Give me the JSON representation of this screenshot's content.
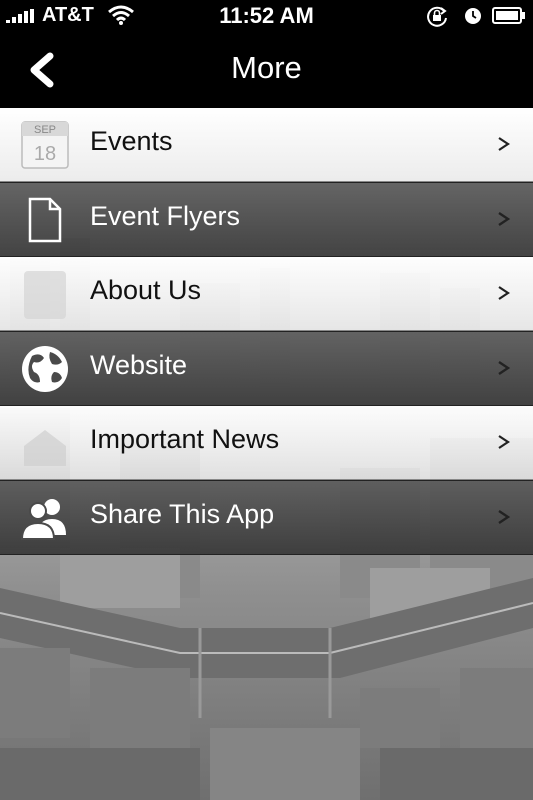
{
  "status_bar": {
    "carrier": "AT&T",
    "time": "11:52 AM"
  },
  "nav": {
    "title": "More"
  },
  "menu": {
    "items": [
      {
        "label": "Events",
        "icon": "calendar-icon",
        "calendar_month": "SEP",
        "calendar_day": "18"
      },
      {
        "label": "Event Flyers",
        "icon": "document-icon"
      },
      {
        "label": "About Us",
        "icon": "info-icon"
      },
      {
        "label": "Website",
        "icon": "globe-icon"
      },
      {
        "label": "Important News",
        "icon": "news-icon"
      },
      {
        "label": "Share This App",
        "icon": "people-icon"
      }
    ]
  },
  "colors": {
    "bar_black": "#000000",
    "row_light": "#f2f2f2",
    "row_dark": "#4a4a4a"
  }
}
